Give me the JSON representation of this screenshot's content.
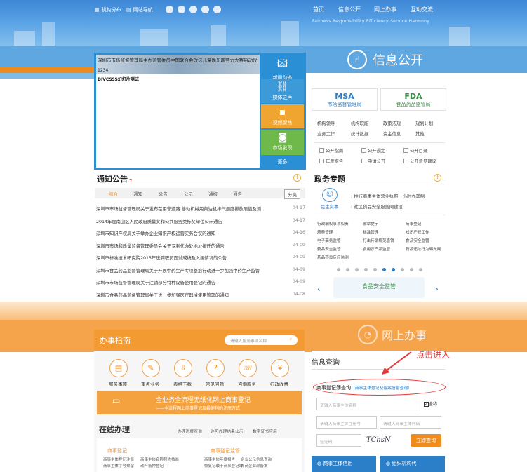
{
  "header": {
    "links": [
      "机构分布",
      "网站导航"
    ],
    "nav": [
      "首页",
      "信息公开",
      "网上办事",
      "互动交流"
    ],
    "subtitle": "Fairness  Responsibility  Efficiency  Service  Harmony"
  },
  "xxgk_title": "信息公开",
  "carousel": {
    "title": "深圳市市场监督管理局主办监管委员中国联合会改亿儿童晚乐趣劳力大赛启动仪式",
    "date": "1234",
    "subtitle": "DIVCSSS幻灯片测试",
    "tiles": [
      "新闻动态",
      "媒体之声",
      "视频聚焦",
      "市场发现",
      "更多"
    ]
  },
  "notices": {
    "title": "通知公告",
    "more_label": "分类",
    "tabs": [
      "综合",
      "通知",
      "公告",
      "公示",
      "通报",
      "通告"
    ],
    "rows": [
      {
        "t": "深圳市市场监督管理局关于发布在用非道路 移动机械用柴油机排气烟度排放限值及测",
        "d": "04-17"
      },
      {
        "t": "2014年度南山区人民政府质量奖和公共服务类标奖单位公示通告",
        "d": "04-17"
      },
      {
        "t": "深圳市知识产权局关于举办企业知识产权运营实务会议的通知",
        "d": "04-16"
      },
      {
        "t": "深圳市市场和质量监督管理委员会关于专利代办处地址搬迁的通告",
        "d": "04-09"
      },
      {
        "t": "深圳市标准技术研究院2015年选聘职员面试成绩及入围情况的公告",
        "d": "04-09"
      },
      {
        "t": "深圳市食品药品监督管理局关于开展中药生产专项整治行动进一步加强中药生产监管",
        "d": "04-09"
      },
      {
        "t": "深圳市市场监督管理局关于注销部分特种设备使用登记的通告",
        "d": "04-09"
      },
      {
        "t": "深圳市食品药品监督管理局关于进一步加强医疗器械使用管理的通知",
        "d": "04-08"
      }
    ]
  },
  "logos": [
    {
      "abbr": "MSA",
      "name": "市场监督管理局"
    },
    {
      "abbr": "FDA",
      "name": "食品药品监管局"
    }
  ],
  "gk_links": [
    "机构领导",
    "机构职能",
    "政策法规",
    "规划计划",
    "业务工作",
    "统计数据",
    "资金信息",
    "其他"
  ],
  "gk_icons": [
    "公开指南",
    "公开规定",
    "公开目录",
    "年度报告",
    "申请公开",
    "公开意见建议"
  ],
  "zwzt": {
    "title": "政务专题",
    "icon_label": "民生实事",
    "items": [
      "推行商事主体营业执照一小时办理制",
      "社区药品安全服务网建设"
    ],
    "grid": [
      "行政职权事项权责",
      "徽章提示",
      "商事登记",
      "质量管理",
      "标准管理",
      "知识产权工作",
      "电子商务监管",
      "打击传销规范直销",
      "食品安全监管",
      "药品安全监管",
      "食用农产品监管",
      "药品违法行为曝光网",
      "药品不良反应监测"
    ],
    "banner": "食品安全监管"
  },
  "wsbs_title": "网上办事",
  "annotation": "点击进入",
  "bszn": {
    "title": "办事指南",
    "search_placeholder": "请输入服务事项名称",
    "icons": [
      "服务事项",
      "重点业务",
      "表格下载",
      "常见问题",
      "咨询服务",
      "行政收费"
    ],
    "banner_main": "全业务全流程无纸化网上商事登记",
    "banner_sub": "——全流程网上商事登记及最便利的注册方式",
    "online_title": "在线办理",
    "online_links": [
      "办理进度查询",
      "许可办理结果公示",
      "数字证书应用"
    ],
    "cards": [
      {
        "title": "商事登记",
        "lines": [
          "商事主体登记注册",
          "商事主体名称预先核准",
          "商事主体字号预留",
          "动产抵押登记"
        ]
      },
      {
        "title": "商事登记监管",
        "lines": [
          "商事主体年度报告",
          "企业公示信息查询",
          "恢复记载于商事登记簿",
          "外商企业部备案"
        ]
      }
    ]
  },
  "xxcx": {
    "title": "信息查询",
    "link": "商事登记簿查询",
    "hint": "（商事主体登记及备案信息查询）",
    "ph1": "请输入商事主体名称",
    "all": "全称",
    "ph2": "请输入商事主体注册号",
    "ph3": "请输入商事主体代码",
    "ph4": "验证码",
    "captcha": "TChsN",
    "btn": "立即查询",
    "bottom": [
      "商事主体信用",
      "组织机构代"
    ]
  }
}
